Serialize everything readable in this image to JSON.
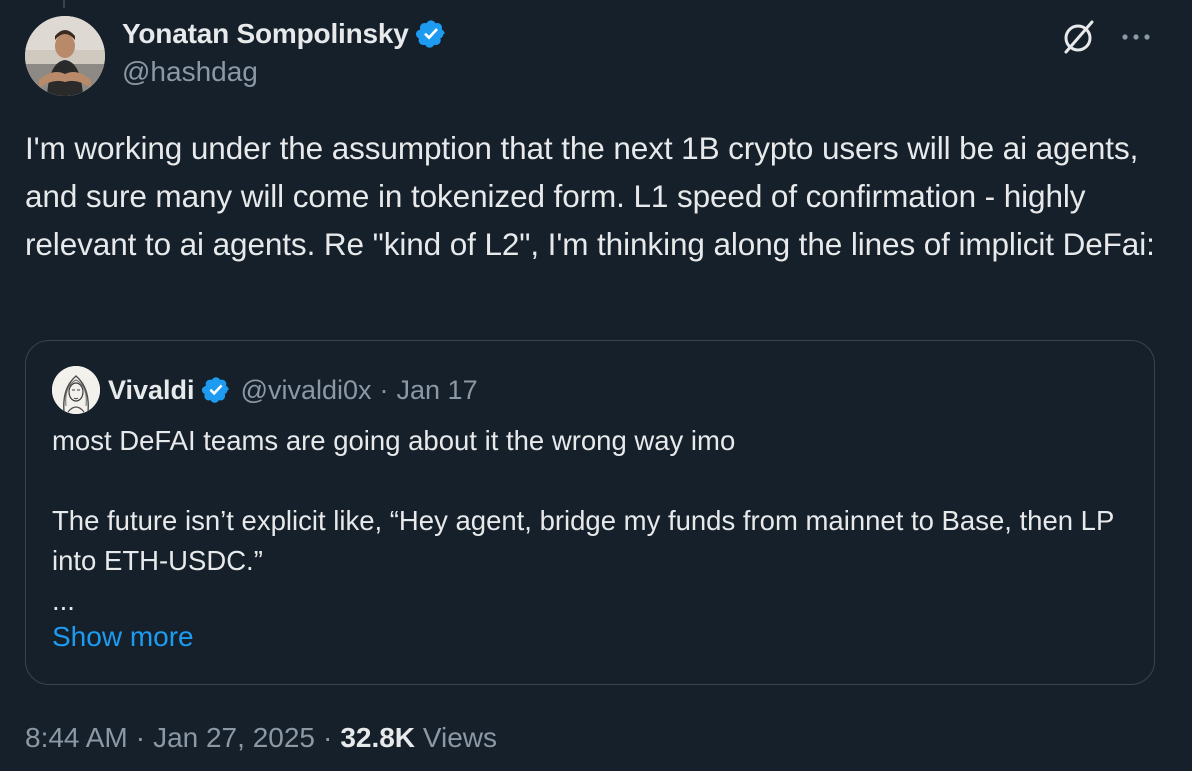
{
  "author": {
    "display_name": "Yonatan Sompolinsky",
    "handle": "@hashdag",
    "verified_icon": "verified-badge-icon"
  },
  "icons": {
    "grok": "grok-icon",
    "more": "more-options-icon"
  },
  "tweet": {
    "text": "I'm working under the assumption that the next 1B crypto users will be ai agents, and sure many will come in tokenized form. L1 speed of confirmation - highly relevant to ai agents. Re \"kind of L2\", I'm thinking along the lines of implicit DeFai:"
  },
  "quote": {
    "display_name": "Vivaldi",
    "handle": "@vivaldi0x",
    "separator": "·",
    "date": "Jan 17",
    "line1": "most DeFAI teams are going about it the wrong way imo",
    "line2": "The future isn’t explicit like, “Hey agent, bridge my funds from mainnet to Base, then LP into ETH-USDC.”",
    "ellipsis": "...",
    "show_more": "Show more"
  },
  "meta": {
    "time": "8:44 AM",
    "separator": "·",
    "date": "Jan 27, 2025",
    "views_count": "32.8K",
    "views_label": "Views"
  },
  "colors": {
    "background": "#15202b",
    "text_primary": "#e7e9ea",
    "text_secondary": "#8b98a5",
    "border": "#38444d",
    "accent": "#1d9bf0"
  }
}
